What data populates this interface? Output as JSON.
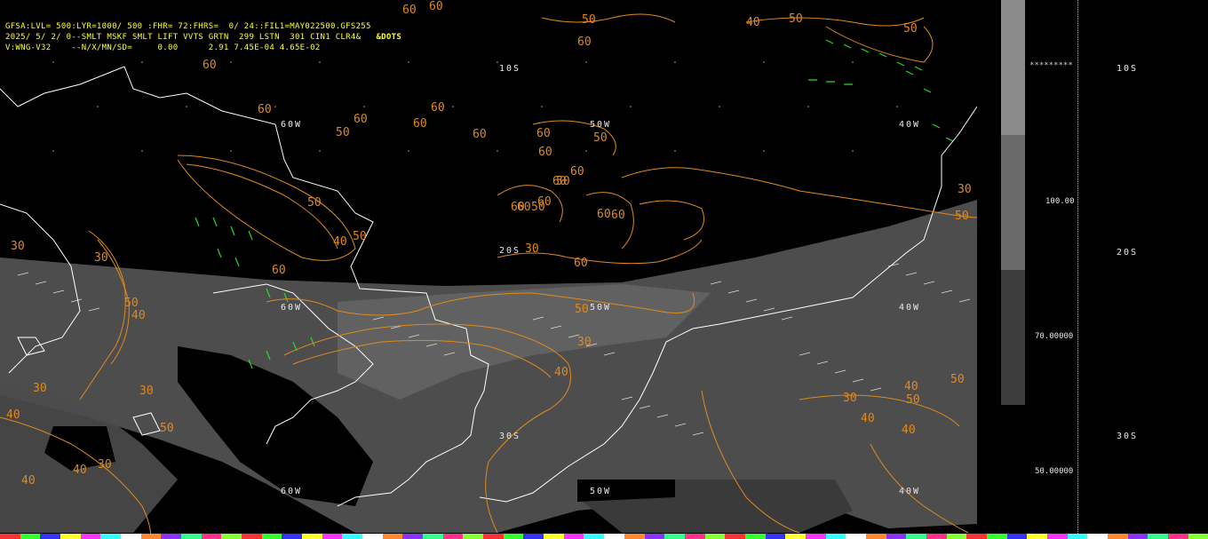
{
  "header": {
    "line1": "GFSA:LVL= 500:LYR=1000/ 500 :FHR= 72:FHRS=  0/ 24::FIL1=MAY022500.GFS255",
    "line2": "2025/ 5/ 2/ 0--SMLT MSKF SMLT LIFT VVTS GRTN  299 LSTN  301 CIN1 CLR4&",
    "line2_tag": "&DOTS",
    "line3": "V:WNG-V32    --N/X/MN/SD=     0.00      2.91 7.45E-04 4.65E-02"
  },
  "map_labels": {
    "lat_10s": "10S",
    "lat_20s": "20S",
    "lat_30s": "30S",
    "lon_60w_top": "60W",
    "lon_50w_top": "50W",
    "lon_40w_top": "40W",
    "lon_60w_mid": "60W",
    "lon_50w_mid": "50W",
    "lon_40w_mid": "40W",
    "lon_60w_bot": "60W",
    "lon_50w_bot": "50W",
    "lon_40w_bot": "40W"
  },
  "contour_labels": [
    "60",
    "60",
    "50",
    "60",
    "60",
    "60",
    "60",
    "60",
    "50",
    "60",
    "60",
    "60",
    "50",
    "60",
    "60",
    "60",
    "50",
    "60",
    "50",
    "60",
    "60",
    "60",
    "60",
    "60",
    "60",
    "50",
    "30",
    "30",
    "50",
    "40",
    "30",
    "50",
    "30",
    "40",
    "30",
    "50",
    "30",
    "40",
    "50",
    "40",
    "30",
    "40",
    "40",
    "50",
    "30",
    "40",
    "40",
    "50",
    "40",
    "30",
    "50",
    "50",
    "40",
    "50"
  ],
  "scale_legend": {
    "values": [
      "100.00",
      "70.00000",
      "50.00000"
    ],
    "stars": "*********",
    "lat_10s": "10S",
    "lat_20s": "20S",
    "lat_30s": "30S"
  },
  "colors": {
    "contour": "#e08a1e",
    "coastline": "#ffffff",
    "shade_gray": "#5a5a5a",
    "barb_green": "#22dd22",
    "header_text": "#ffff33",
    "scale_light": "#8a8a8a",
    "scale_mid": "#6a6a6a",
    "scale_dark": "#3c3c3c"
  }
}
